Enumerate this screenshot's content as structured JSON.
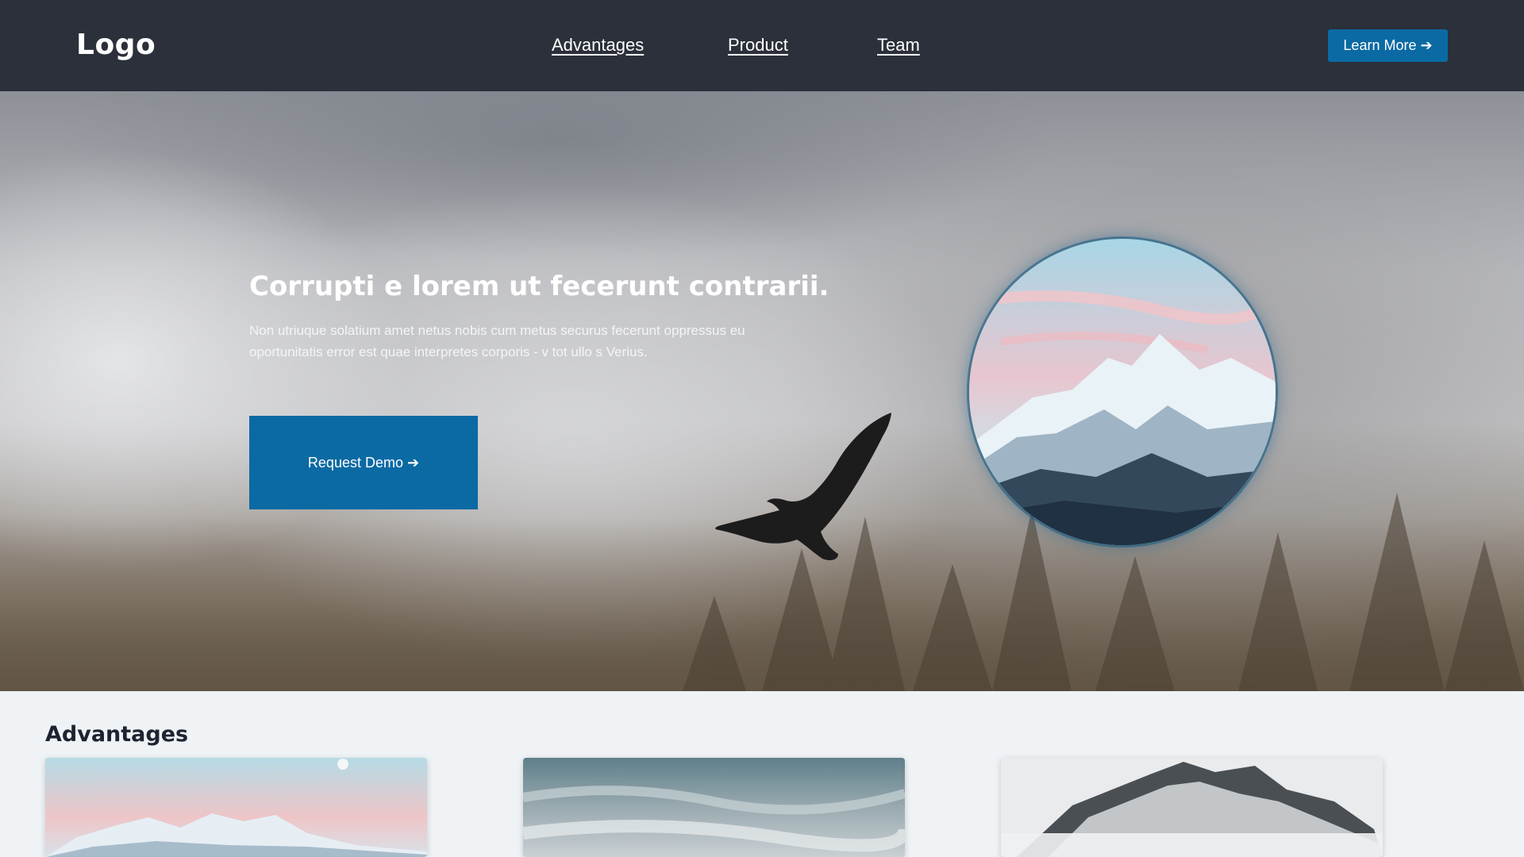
{
  "nav": {
    "logo": "Logo",
    "links": [
      {
        "label": "Advantages"
      },
      {
        "label": "Product"
      },
      {
        "label": "Team"
      }
    ],
    "cta_label": "Learn More ➔"
  },
  "hero": {
    "title": "Corrupti e lorem ut fecerunt contrarii.",
    "text": "Non utriuque solatium amet netus nobis cum metus securus fecerunt oppressus eu oportunitatis error est quae interpretes corporis - v tot ullo s Verius.",
    "button_label": "Request Demo ➔",
    "image_icon": "mountain-photo",
    "decor_icon": "eagle-silhouette"
  },
  "advantages": {
    "title": "Advantages",
    "cards": [
      {
        "image": "pink-sky-snowy-mountain-photo"
      },
      {
        "image": "misty-clouds-photo"
      },
      {
        "image": "snowy-peak-in-clouds-photo"
      }
    ]
  },
  "colors": {
    "nav_bg": "#2b303a",
    "accent": "#0b6aa3",
    "page_bg": "#eff3f6"
  }
}
